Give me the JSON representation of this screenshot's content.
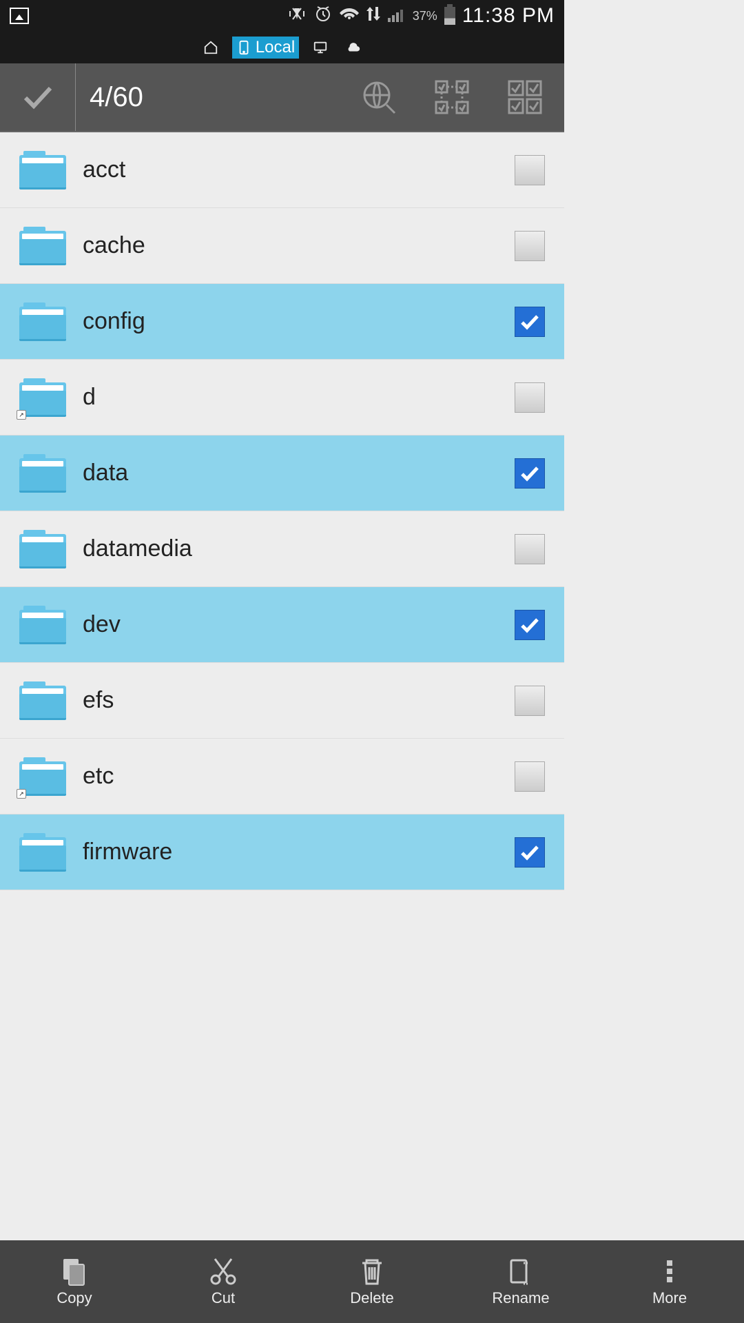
{
  "status": {
    "time": "11:38 PM",
    "battery_pct": "37%"
  },
  "tabs": {
    "local": "Local"
  },
  "actionbar": {
    "count": "4/60"
  },
  "files": [
    {
      "name": "acct",
      "selected": false,
      "shortcut": false
    },
    {
      "name": "cache",
      "selected": false,
      "shortcut": false
    },
    {
      "name": "config",
      "selected": true,
      "shortcut": false
    },
    {
      "name": "d",
      "selected": false,
      "shortcut": true
    },
    {
      "name": "data",
      "selected": true,
      "shortcut": false
    },
    {
      "name": "datamedia",
      "selected": false,
      "shortcut": false
    },
    {
      "name": "dev",
      "selected": true,
      "shortcut": false
    },
    {
      "name": "efs",
      "selected": false,
      "shortcut": false
    },
    {
      "name": "etc",
      "selected": false,
      "shortcut": true
    },
    {
      "name": "firmware",
      "selected": true,
      "shortcut": false
    }
  ],
  "bottom": {
    "copy": "Copy",
    "cut": "Cut",
    "delete": "Delete",
    "rename": "Rename",
    "more": "More"
  }
}
